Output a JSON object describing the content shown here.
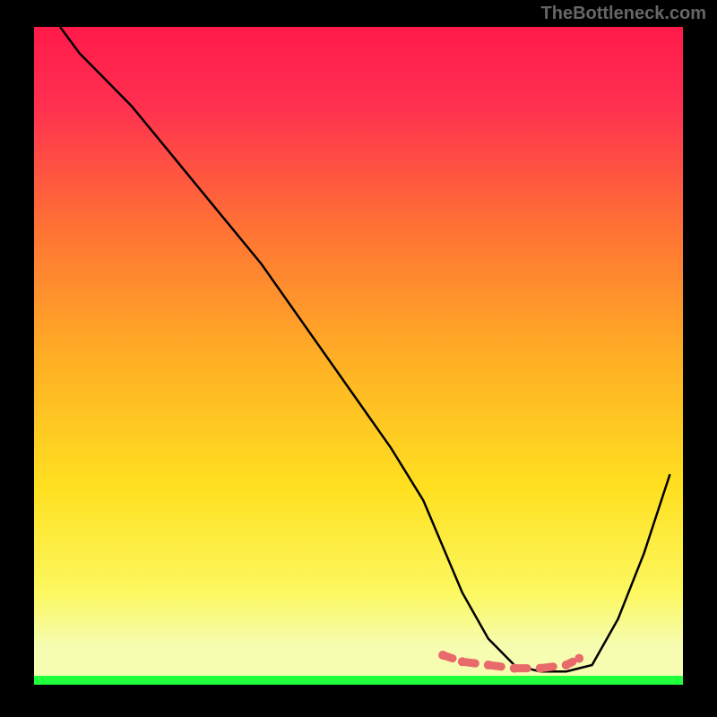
{
  "watermark": "TheBottleneck.com",
  "chart_data": {
    "type": "line",
    "title": "",
    "xlabel": "",
    "ylabel": "",
    "xlim": [
      0,
      100
    ],
    "ylim": [
      0,
      100
    ],
    "background_gradient": {
      "top": "#ff2050",
      "mid1": "#ff7830",
      "mid2": "#ffd820",
      "bottom_band": "#f8fca0",
      "green": "#1eff3a"
    },
    "series": [
      {
        "name": "main-curve",
        "color": "#000000",
        "x": [
          4,
          7,
          10,
          15,
          20,
          25,
          30,
          35,
          40,
          45,
          50,
          55,
          60,
          63,
          66,
          70,
          74,
          78,
          82,
          86,
          90,
          94,
          98
        ],
        "y": [
          100,
          96,
          93,
          88,
          82,
          76,
          70,
          64,
          57,
          50,
          43,
          36,
          28,
          21,
          14,
          7,
          3,
          2,
          2,
          3,
          10,
          20,
          32
        ]
      },
      {
        "name": "bottom-marker",
        "color": "#e86a6a",
        "style": "thick-dashed",
        "x": [
          63,
          66,
          70,
          74,
          78,
          82,
          84
        ],
        "y": [
          4.5,
          3.5,
          3,
          2.5,
          2.5,
          3,
          4
        ]
      }
    ]
  }
}
